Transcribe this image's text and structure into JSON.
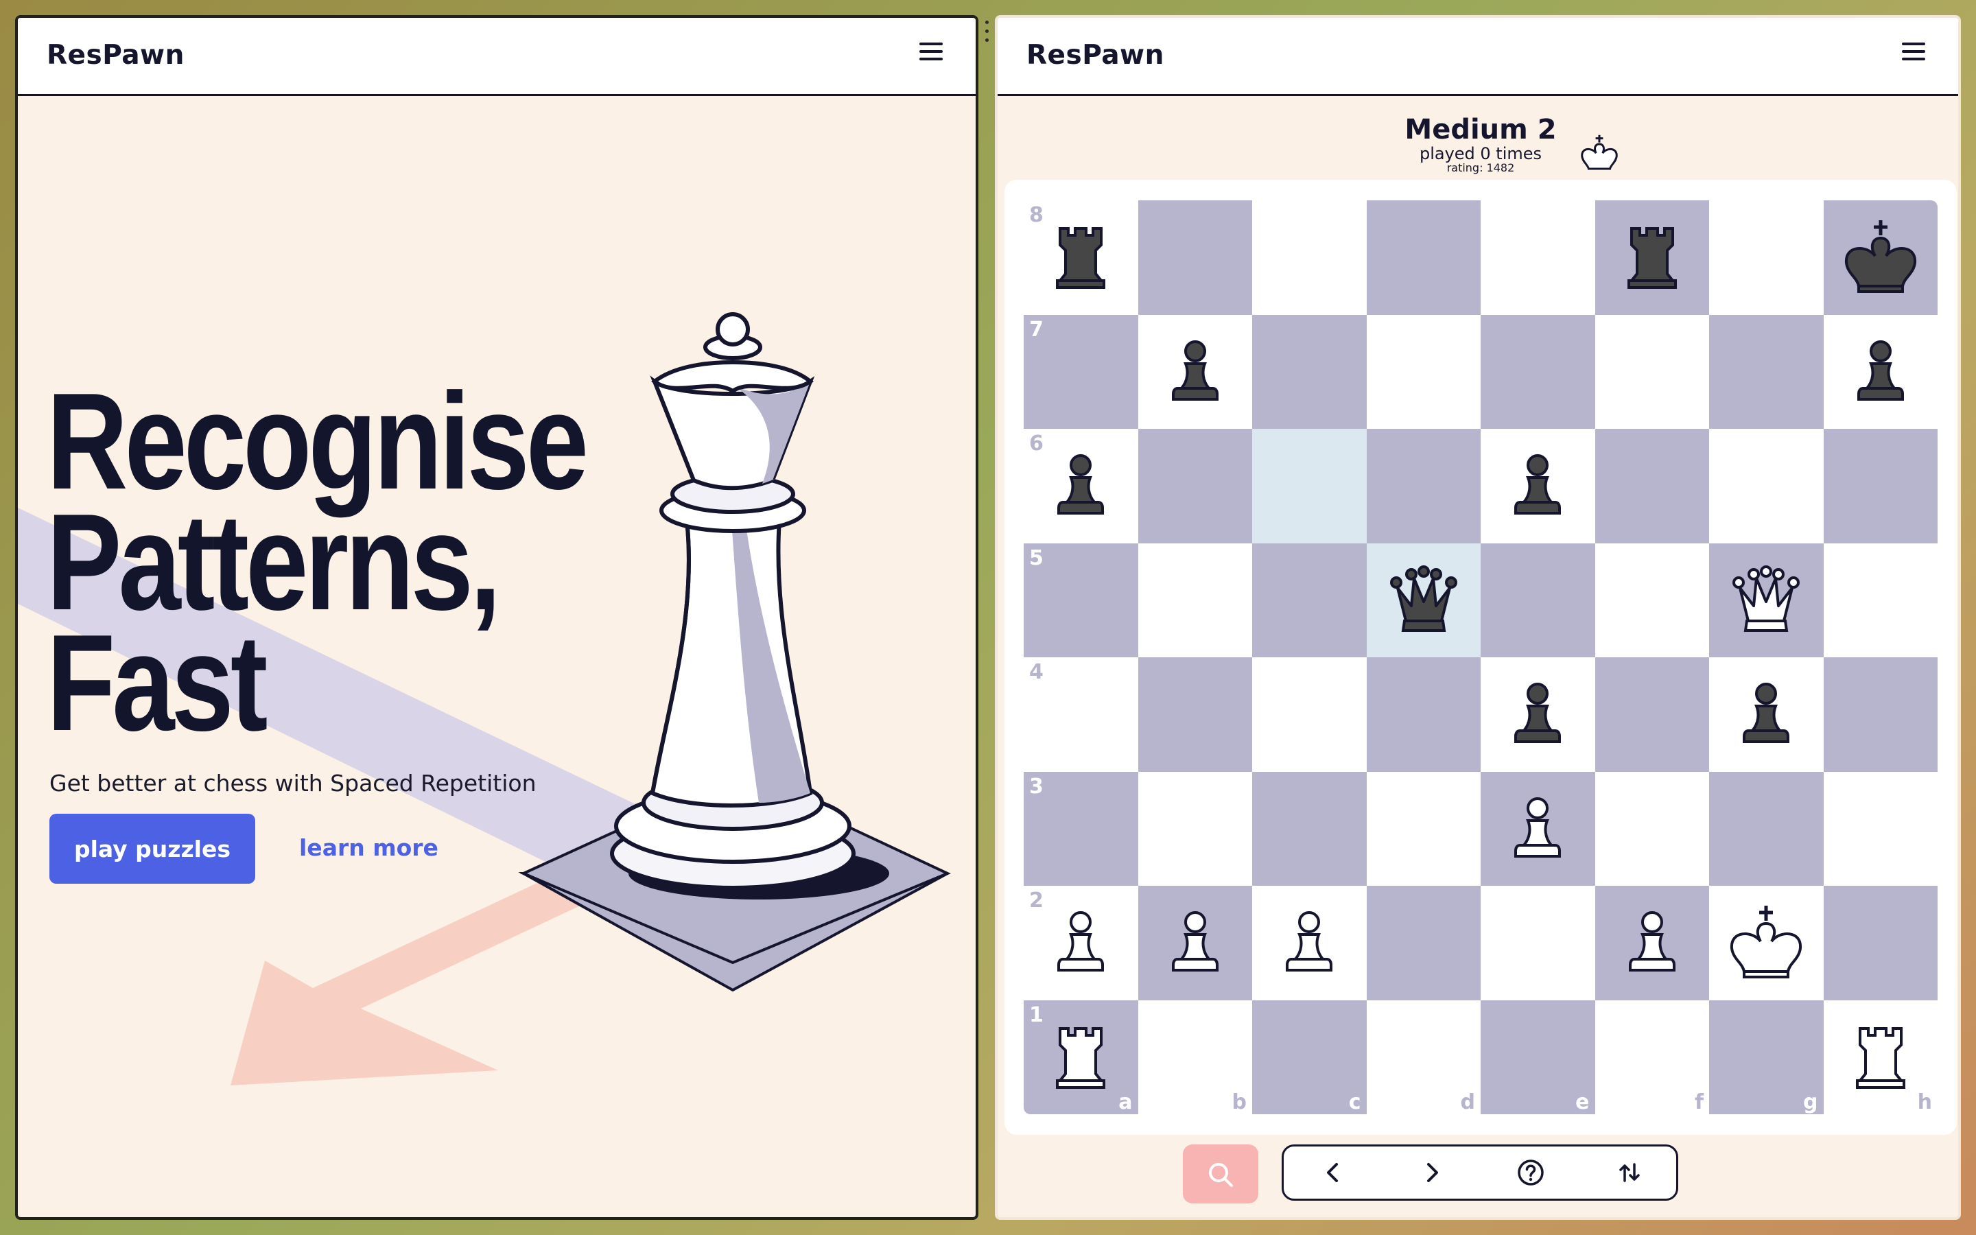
{
  "left_app": {
    "brand": "ResPawn",
    "hero": {
      "title_lines": [
        "Recognise",
        "Patterns,",
        "Fast"
      ],
      "subtitle": "Get better at chess with Spaced Repetition",
      "primary_button": "play puzzles",
      "secondary_link": "learn more"
    }
  },
  "right_app": {
    "brand": "ResPawn",
    "puzzle": {
      "name": "Medium 2",
      "played": "played 0 times",
      "rating": "rating: 1482",
      "side_to_move_icon": "white-king-icon"
    },
    "board": {
      "files": [
        "a",
        "b",
        "c",
        "d",
        "e",
        "f",
        "g",
        "h"
      ],
      "ranks": [
        "8",
        "7",
        "6",
        "5",
        "4",
        "3",
        "2",
        "1"
      ],
      "highlighted_squares": [
        "c6",
        "d5"
      ],
      "pieces": [
        {
          "square": "a8",
          "piece": "rook",
          "color": "black"
        },
        {
          "square": "f8",
          "piece": "rook",
          "color": "black"
        },
        {
          "square": "h8",
          "piece": "king",
          "color": "black"
        },
        {
          "square": "b7",
          "piece": "pawn",
          "color": "black"
        },
        {
          "square": "h7",
          "piece": "pawn",
          "color": "black"
        },
        {
          "square": "a6",
          "piece": "pawn",
          "color": "black"
        },
        {
          "square": "e6",
          "piece": "pawn",
          "color": "black"
        },
        {
          "square": "d5",
          "piece": "queen",
          "color": "black"
        },
        {
          "square": "g5",
          "piece": "queen",
          "color": "white"
        },
        {
          "square": "e4",
          "piece": "pawn",
          "color": "black"
        },
        {
          "square": "g4",
          "piece": "pawn",
          "color": "black"
        },
        {
          "square": "e3",
          "piece": "pawn",
          "color": "white"
        },
        {
          "square": "a2",
          "piece": "pawn",
          "color": "white"
        },
        {
          "square": "b2",
          "piece": "pawn",
          "color": "white"
        },
        {
          "square": "c2",
          "piece": "pawn",
          "color": "white"
        },
        {
          "square": "f2",
          "piece": "pawn",
          "color": "white"
        },
        {
          "square": "g2",
          "piece": "king",
          "color": "white"
        },
        {
          "square": "a1",
          "piece": "rook",
          "color": "white"
        },
        {
          "square": "h1",
          "piece": "rook",
          "color": "white"
        }
      ]
    },
    "controls": [
      {
        "name": "search-icon"
      },
      {
        "name": "chevron-left-icon"
      },
      {
        "name": "chevron-right-icon"
      },
      {
        "name": "help-circle-icon"
      },
      {
        "name": "flip-board-icon"
      }
    ]
  },
  "colors": {
    "accent": "#4c61e4",
    "panel_bg": "#fcf1e6",
    "dark_square": "#b6b5cd",
    "light_square": "#ffffff",
    "highlight_square": "#dbe8ef",
    "search_button": "#f8b4b2",
    "ink": "#15162e"
  }
}
